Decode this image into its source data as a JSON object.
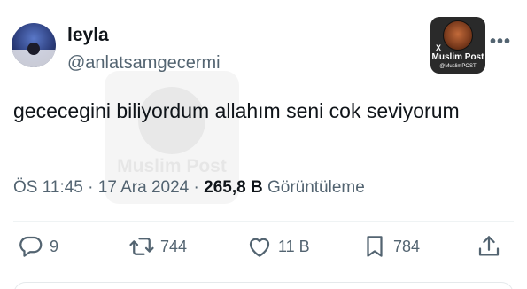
{
  "author": {
    "name": "leyla",
    "handle": "@anlatsamgecermi"
  },
  "badge": {
    "x_label": "X",
    "name": "Muslim Post",
    "handle": "@MuslimPOST"
  },
  "watermark": {
    "name": "Muslim Post"
  },
  "more_label": "•••",
  "tweet_text": "gececegini biliyordum allahım seni cok seviyorum",
  "meta": {
    "time": "ÖS 11:45",
    "separator": " · ",
    "date": "17 Ara 2024",
    "views": "265,8 B",
    "views_label": "Görüntüleme"
  },
  "actions": {
    "replies": "9",
    "reposts": "744",
    "likes": "11 B",
    "bookmarks": "784"
  },
  "icons": {
    "reply": "reply-icon",
    "repost": "repost-icon",
    "like": "heart-icon",
    "bookmark": "bookmark-icon",
    "share": "share-icon",
    "more": "more-icon"
  },
  "colors": {
    "text": "#0f1419",
    "secondary": "#536471",
    "divider": "#eff3f4"
  }
}
